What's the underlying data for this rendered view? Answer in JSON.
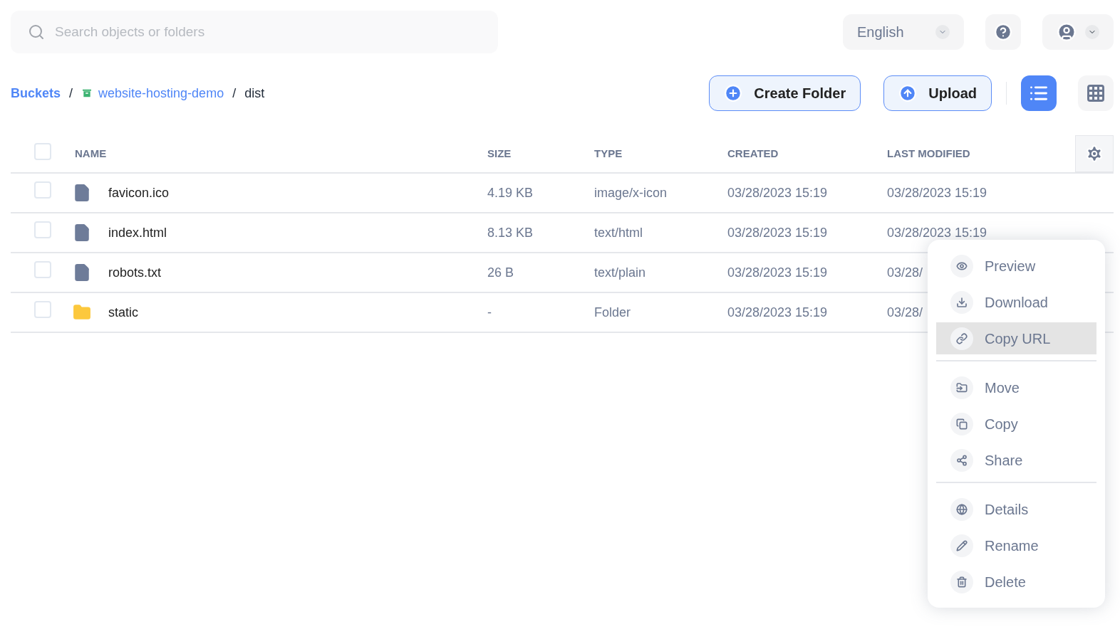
{
  "search": {
    "placeholder": "Search objects or folders"
  },
  "language": {
    "value": "English"
  },
  "breadcrumb": [
    {
      "label": "Buckets",
      "kind": "root"
    },
    {
      "label": "/",
      "kind": "separator"
    },
    {
      "label": "website-hosting-demo",
      "kind": "bucket"
    },
    {
      "label": "/",
      "kind": "separator"
    },
    {
      "label": "dist",
      "kind": "current"
    }
  ],
  "actions": [
    {
      "label": "Create Folder"
    },
    {
      "label": "Upload"
    }
  ],
  "views": [
    {
      "kind": "list",
      "selected": true
    },
    {
      "kind": "grid",
      "selected": false
    }
  ],
  "table": {
    "select_all": {
      "checked": false
    },
    "columns": [
      "NAME",
      "SIZE",
      "TYPE",
      "CREATED",
      "LAST MODIFIED"
    ],
    "rows": [
      {
        "kind": "file",
        "checked": false,
        "name": "favicon.ico",
        "size": "4.19 KB",
        "type": "image/x-icon",
        "created": "03/28/2023 15:19",
        "last_modified": "03/28/2023 15:19"
      },
      {
        "kind": "file",
        "checked": false,
        "name": "index.html",
        "size": "8.13 KB",
        "type": "text/html",
        "created": "03/28/2023 15:19",
        "last_modified": "03/28/2023 15:19"
      },
      {
        "kind": "file",
        "checked": false,
        "name": "robots.txt",
        "size": "26 B",
        "type": "text/plain",
        "created": "03/28/2023 15:19",
        "last_modified": "03/28/"
      },
      {
        "kind": "folder",
        "checked": false,
        "name": "static",
        "size": "-",
        "type": "Folder",
        "created": "03/28/2023 15:19",
        "last_modified": "03/28/"
      }
    ]
  },
  "context_menu": [
    [
      {
        "label": "Preview",
        "selected": false
      },
      {
        "label": "Download",
        "selected": false
      },
      {
        "label": "Copy URL",
        "selected": true
      }
    ],
    [
      {
        "label": "Move",
        "selected": false
      },
      {
        "label": "Copy",
        "selected": false
      },
      {
        "label": "Share",
        "selected": false
      }
    ],
    [
      {
        "label": "Details",
        "selected": false
      },
      {
        "label": "Rename",
        "selected": false
      },
      {
        "label": "Delete",
        "selected": false
      }
    ]
  ]
}
